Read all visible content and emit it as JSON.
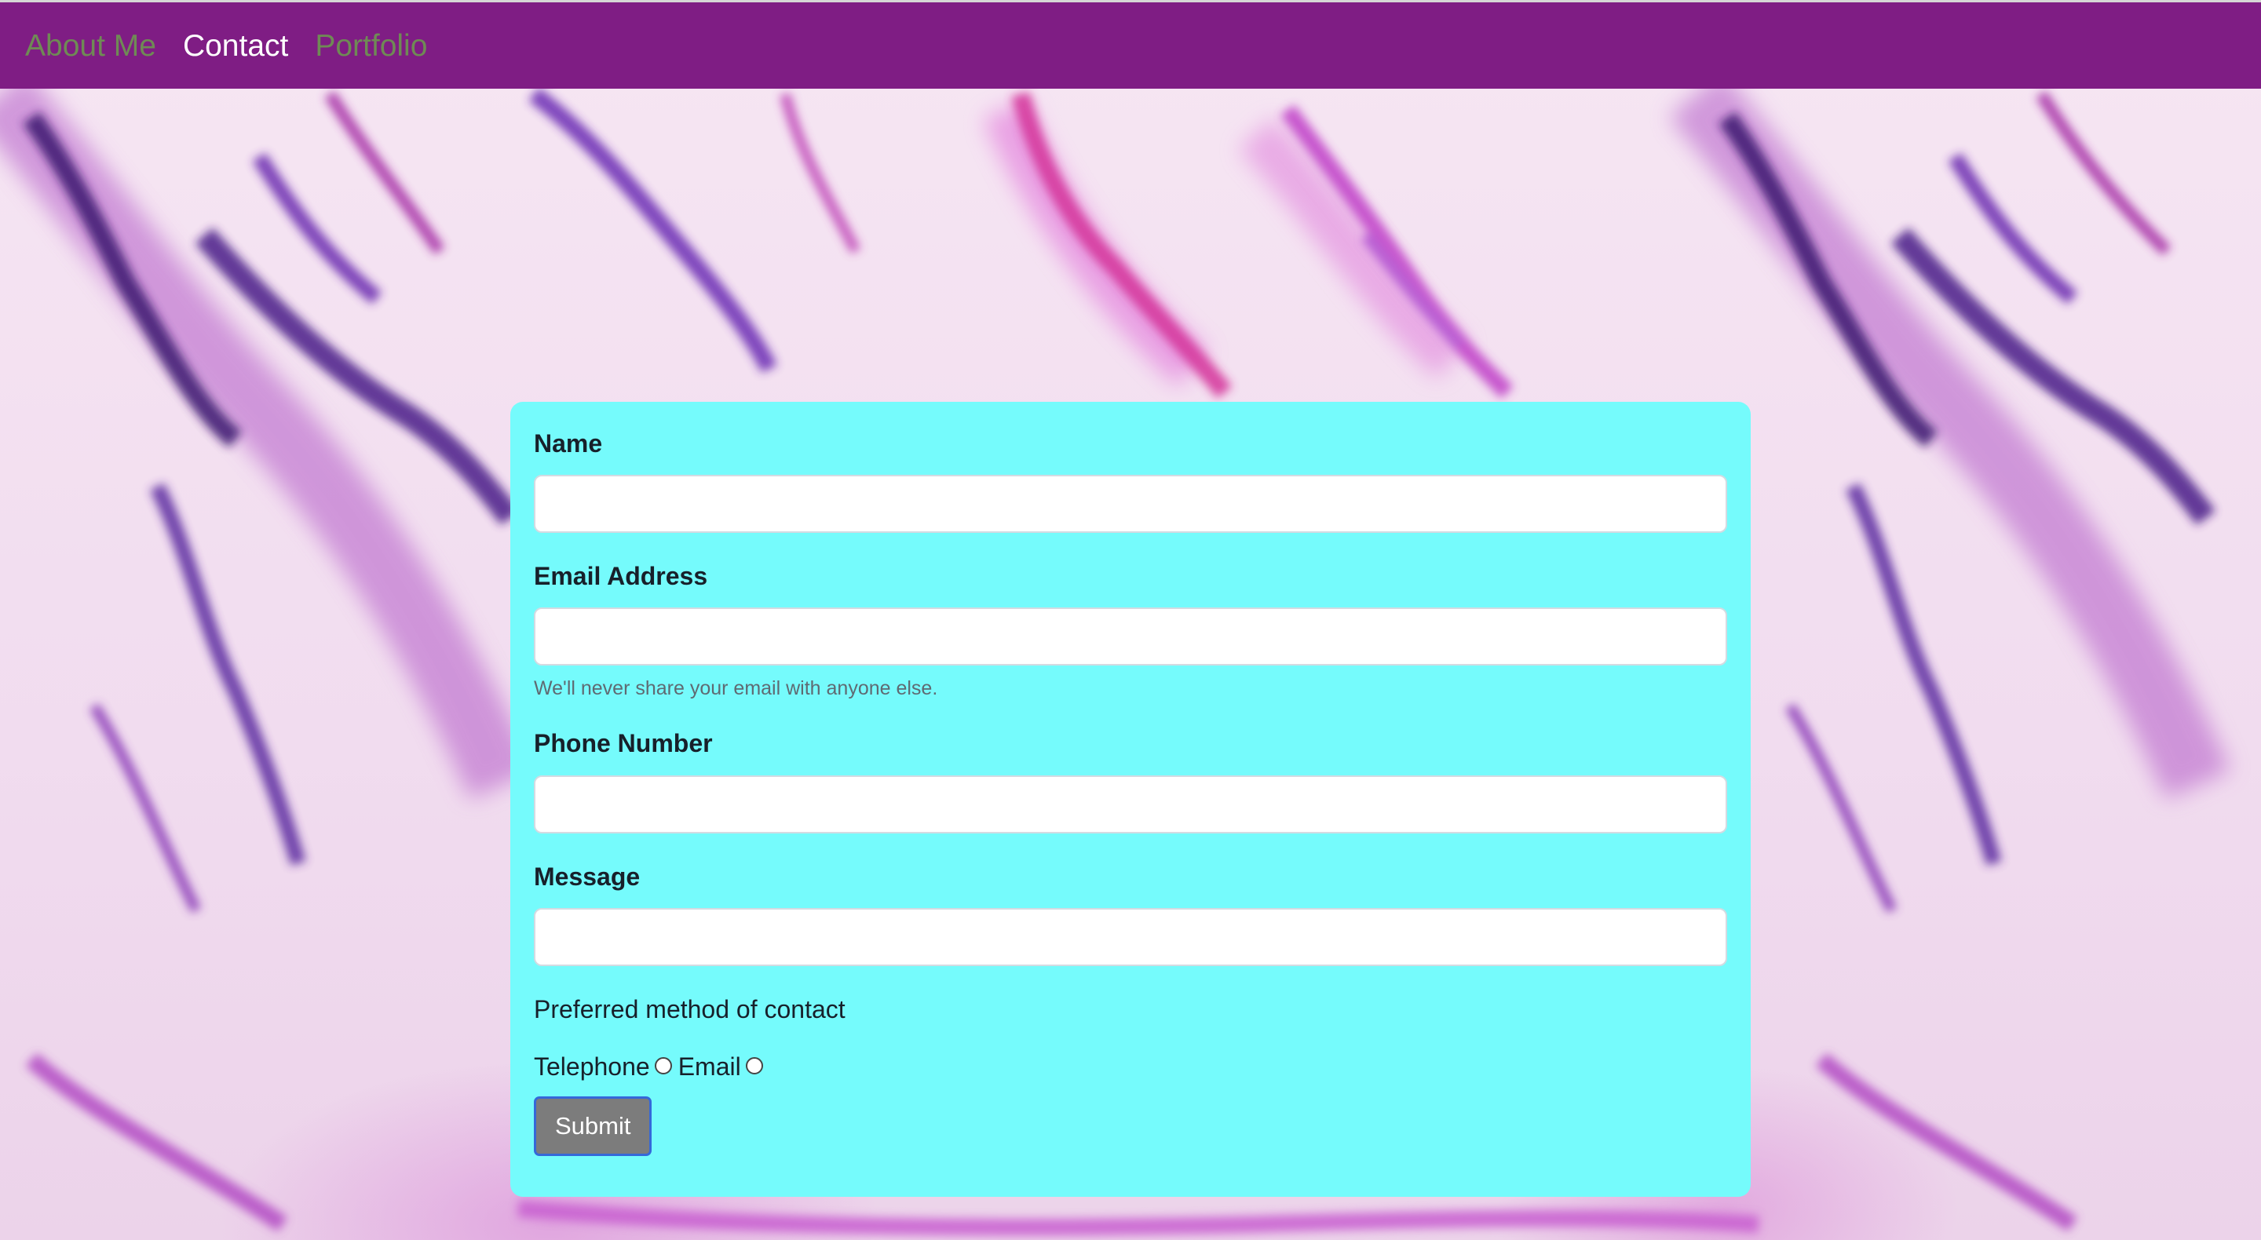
{
  "nav": {
    "links": [
      {
        "label": "About Me",
        "state": "inactive"
      },
      {
        "label": "Contact",
        "state": "active"
      },
      {
        "label": "Portfolio",
        "state": "inactive"
      }
    ]
  },
  "form": {
    "name": {
      "label": "Name",
      "value": "",
      "placeholder": ""
    },
    "email": {
      "label": "Email Address",
      "value": "",
      "placeholder": "",
      "help": "We'll never share your email with anyone else."
    },
    "phone": {
      "label": "Phone Number",
      "value": "",
      "placeholder": ""
    },
    "message": {
      "label": "Message",
      "value": "",
      "placeholder": ""
    },
    "contact_method": {
      "title": "Preferred method of contact",
      "options": [
        {
          "label": "Telephone",
          "selected": false
        },
        {
          "label": "Email",
          "selected": false
        }
      ]
    },
    "submit_label": "Submit"
  },
  "colors": {
    "navbar_bg": "#7f1d84",
    "nav_active": "#ffffff",
    "nav_inactive": "#6f8a55",
    "card_bg": "#75fbfc",
    "submit_bg": "#7c7c7c",
    "submit_border": "#3568d8"
  }
}
